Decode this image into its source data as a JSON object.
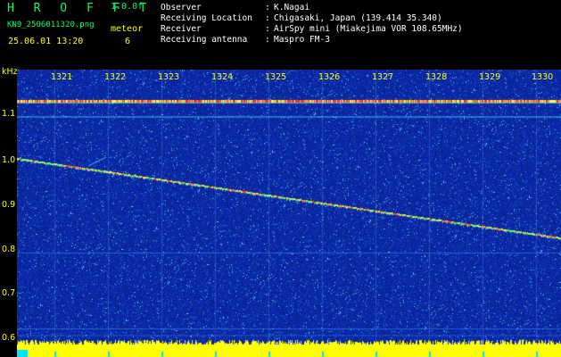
{
  "header": {
    "app_name": "H R O F F T",
    "version": "1.0.0f",
    "filename": "KN9_2506011320.png",
    "mode_label": "meteor",
    "mode_value": "6",
    "datetime": "25.06.01 13:20"
  },
  "info": [
    {
      "label": "Observer",
      "value": "K.Nagai"
    },
    {
      "label": "Receiving Location",
      "value": "Chigasaki, Japan (139.414 35.340)"
    },
    {
      "label": "Receiver",
      "value": "AirSpy mini (Miakejima VOR 108.65MHz)"
    },
    {
      "label": "Receiving antenna",
      "value": "Maspro FM-3"
    }
  ],
  "axis": {
    "unit": "kHz",
    "y_ticks": [
      "1.1",
      "1.0",
      "0.9",
      "0.8",
      "0.7",
      "0.6"
    ],
    "time_ticks": [
      "1321",
      "1322",
      "1323",
      "1324",
      "1325",
      "1326",
      "1327",
      "1328",
      "1329",
      "1330"
    ]
  },
  "colors": {
    "background": "#000000",
    "spectrogram": "#001a8c",
    "noise_floor": "#ffff00",
    "labels": "#ffff00",
    "accent_green": "#00ff66"
  }
}
